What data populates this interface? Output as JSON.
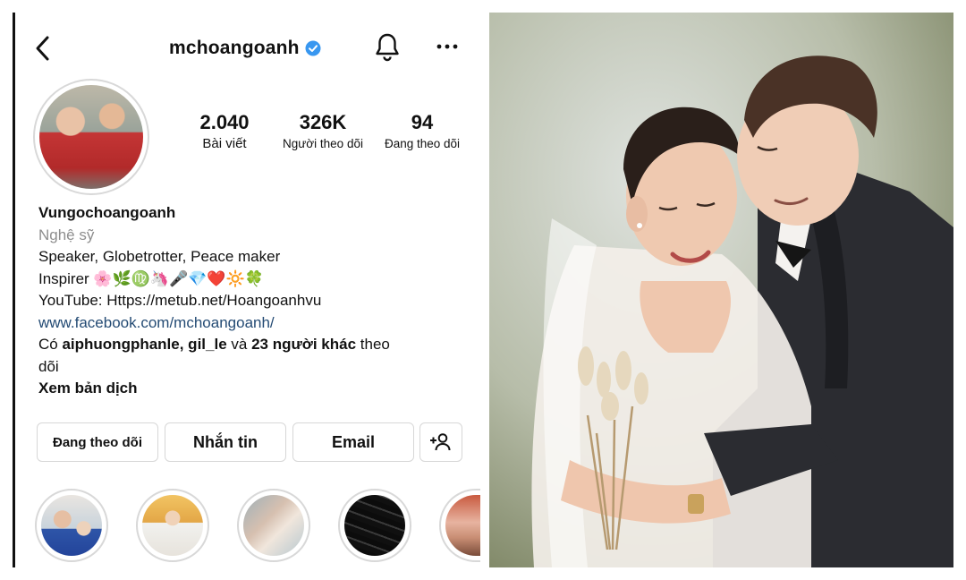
{
  "profile": {
    "username": "mchoangoanh",
    "stats": [
      {
        "value": "2.040",
        "label": "Bài viết"
      },
      {
        "value": "326K",
        "label": "Người theo dõi"
      },
      {
        "value": "94",
        "label": "Đang theo dõi"
      }
    ],
    "display_name": "Vungochoangoanh",
    "category": "Nghệ sỹ",
    "bio_line1": "Speaker, Globetrotter, Peace maker",
    "bio_line2_text": "Inspirer ",
    "bio_line2_emojis": "🌸🌿♍🦄🎤💎❤️🔆🍀",
    "bio_line3": "YouTube: Https://metub.net/Hoangoanhvu",
    "website": "www.facebook.com/mchoangoanh/",
    "followed_by_prefix": "Có ",
    "followed_by_users": "aiphuongphanle, gil_le",
    "followed_by_mid": " và ",
    "followed_by_others": "23 người khác",
    "followed_by_suffix": " theo",
    "followed_by_wrap": "dõi",
    "translate": "Xem bản dịch"
  },
  "actions": {
    "following": "Đang theo dõi",
    "message": "Nhắn tin",
    "email": "Email"
  },
  "icons": {
    "back": "back-arrow-icon",
    "verified": "verified-badge-icon",
    "bell": "bell-icon",
    "more": "more-icon",
    "add_user": "add-user-icon"
  },
  "colors": {
    "verified": "#3897f0",
    "link": "#244b74",
    "muted": "#8e8e8e"
  }
}
